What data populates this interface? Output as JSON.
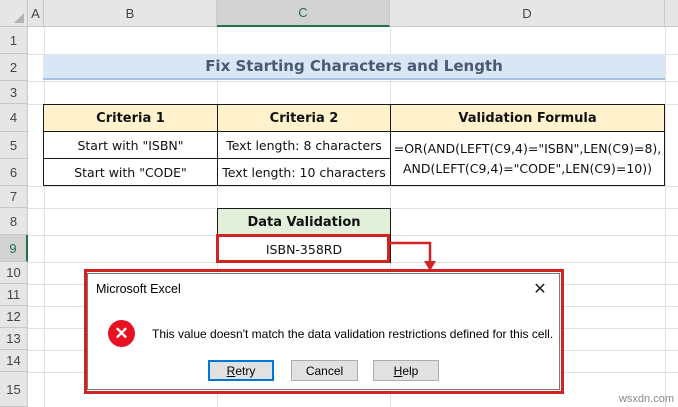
{
  "columns": [
    "A",
    "B",
    "C",
    "D"
  ],
  "rows": [
    "1",
    "2",
    "3",
    "4",
    "5",
    "6",
    "7",
    "8",
    "9",
    "10",
    "11",
    "12",
    "13",
    "14",
    "15"
  ],
  "title": "Fix Starting Characters and Length",
  "table": {
    "headers": [
      "Criteria 1",
      "Criteria 2",
      "Validation Formula"
    ],
    "rows": [
      {
        "c1": "Start with \"ISBN\"",
        "c2": "Text length: 8 characters"
      },
      {
        "c1": "Start with \"CODE\"",
        "c2": "Text length: 10 characters"
      }
    ],
    "formula_line1": "=OR(AND(LEFT(C9,4)=\"ISBN\",LEN(C9)=8),",
    "formula_line2": "AND(LEFT(C9,4)=\"CODE\",LEN(C9)=10))"
  },
  "data_validation": {
    "header": "Data Validation",
    "value": "ISBN-358RD"
  },
  "dialog": {
    "title": "Microsoft Excel",
    "message": "This value doesn't match the data validation restrictions defined for this cell.",
    "buttons": {
      "retry_pre": "",
      "retry_u": "R",
      "retry_post": "etry",
      "cancel": "Cancel",
      "help_u": "H",
      "help_post": "elp"
    },
    "close_glyph": "✕",
    "error_icon": "error-x-icon"
  },
  "watermark": "wsxdn.com",
  "colors": {
    "accent": "#217346",
    "highlight_red": "#d22323",
    "header_fill": "#fff2cc",
    "dv_fill": "#e2efda",
    "title_fill": "#d9e6f4"
  }
}
